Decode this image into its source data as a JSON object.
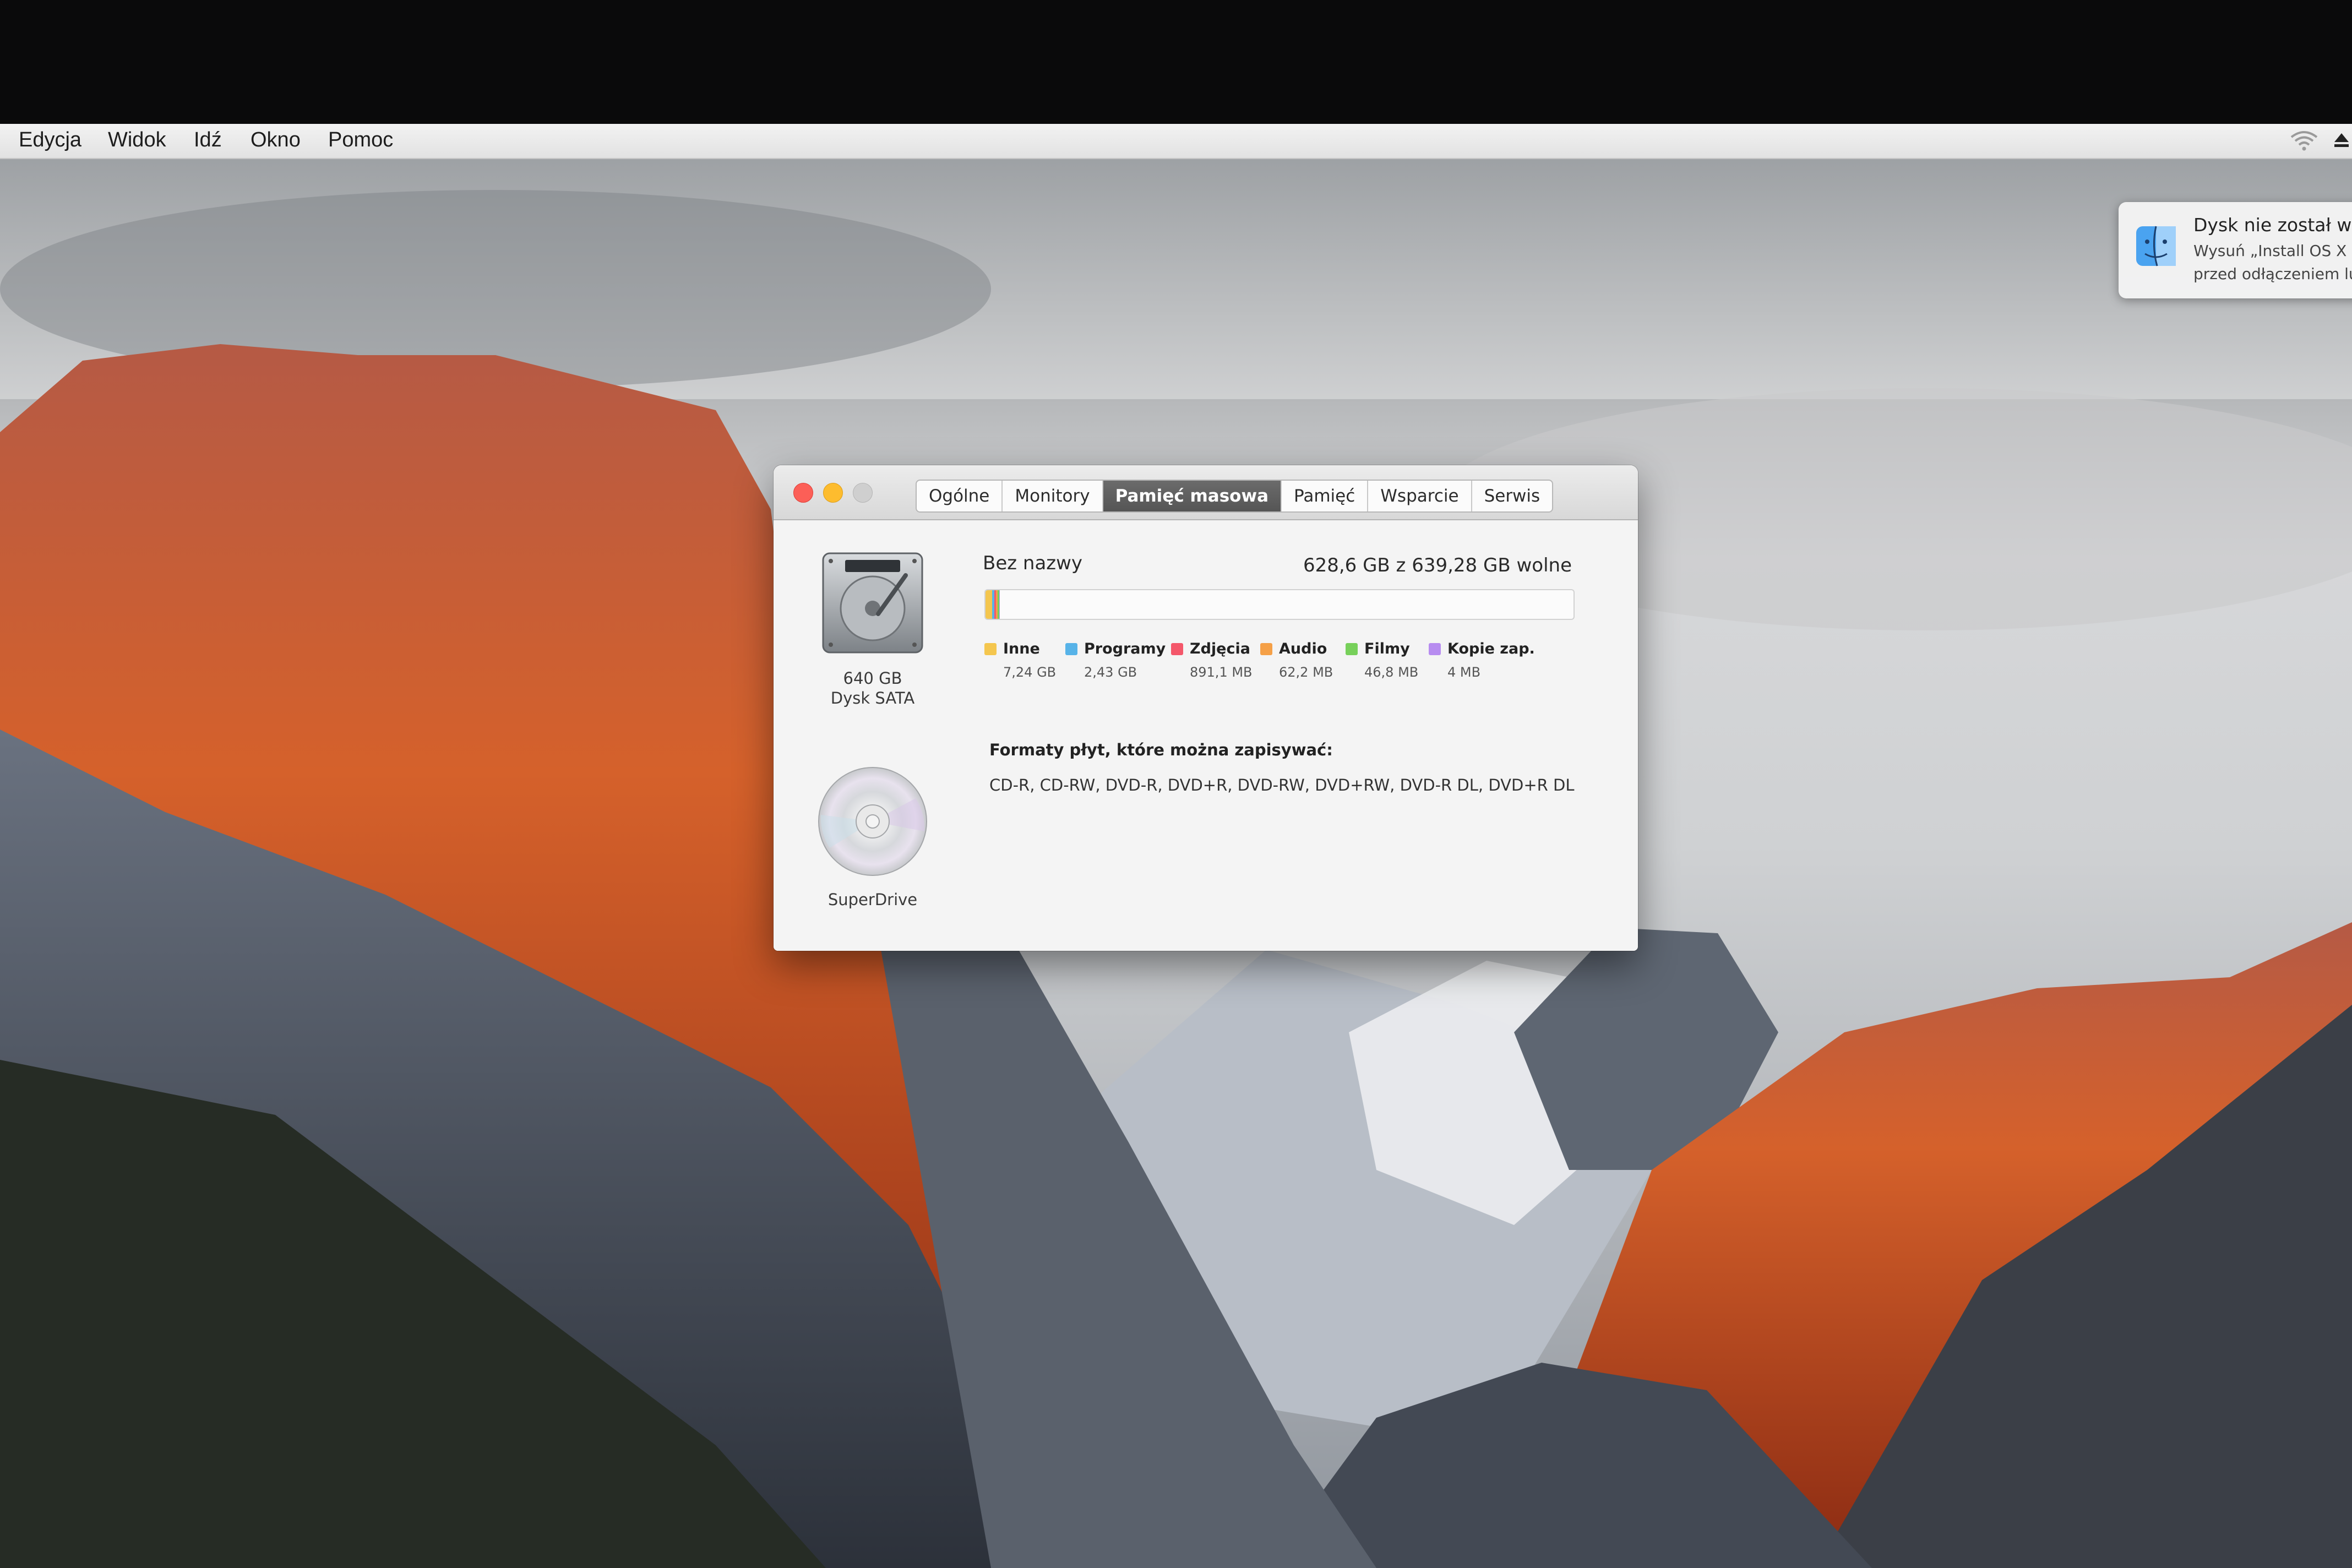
{
  "menubar": {
    "items": [
      "Edycja",
      "Widok",
      "Idź",
      "Okno",
      "Pomoc"
    ],
    "status_icons": [
      "wifi-icon",
      "eject-icon"
    ]
  },
  "notification": {
    "title": "Dysk nie został wys",
    "line1": "Wysuń „Install OS X E",
    "line2": "przed odłączeniem lu",
    "icon": "finder-icon"
  },
  "window": {
    "tabs": [
      "Ogólne",
      "Monitory",
      "Pamięć masowa",
      "Pamięć",
      "Wsparcie",
      "Serwis"
    ],
    "active_tab": "Pamięć masowa",
    "disk": {
      "capacity": "640 GB",
      "type": "Dysk SATA",
      "icon": "hard-drive-icon",
      "volume_name": "Bez nazwy",
      "free_text": "628,6 GB z 639,28 GB wolne",
      "categories": [
        {
          "label": "Inne",
          "size": "7,24 GB",
          "color": "#f4c64e",
          "fraction": 0.0113
        },
        {
          "label": "Programy",
          "size": "2,43 GB",
          "color": "#57b3e8",
          "fraction": 0.0038
        },
        {
          "label": "Zdjęcia",
          "size": "891,1 MB",
          "color": "#f4576a",
          "fraction": 0.0014
        },
        {
          "label": "Audio",
          "size": "62,2 MB",
          "color": "#f5a047",
          "fraction": 0.0001
        },
        {
          "label": "Filmy",
          "size": "46,8 MB",
          "color": "#77d05a",
          "fraction": 0.0001
        },
        {
          "label": "Kopie zap.",
          "size": "4 MB",
          "color": "#b78cf0",
          "fraction": 0.0
        }
      ]
    },
    "superdrive": {
      "label": "SuperDrive",
      "icon": "optical-disc-icon",
      "formats_title": "Formaty płyt, które można zapisywać:",
      "formats": "CD-R, CD-RW, DVD-R, DVD+R, DVD-RW, DVD+RW, DVD-R DL, DVD+R DL"
    }
  }
}
